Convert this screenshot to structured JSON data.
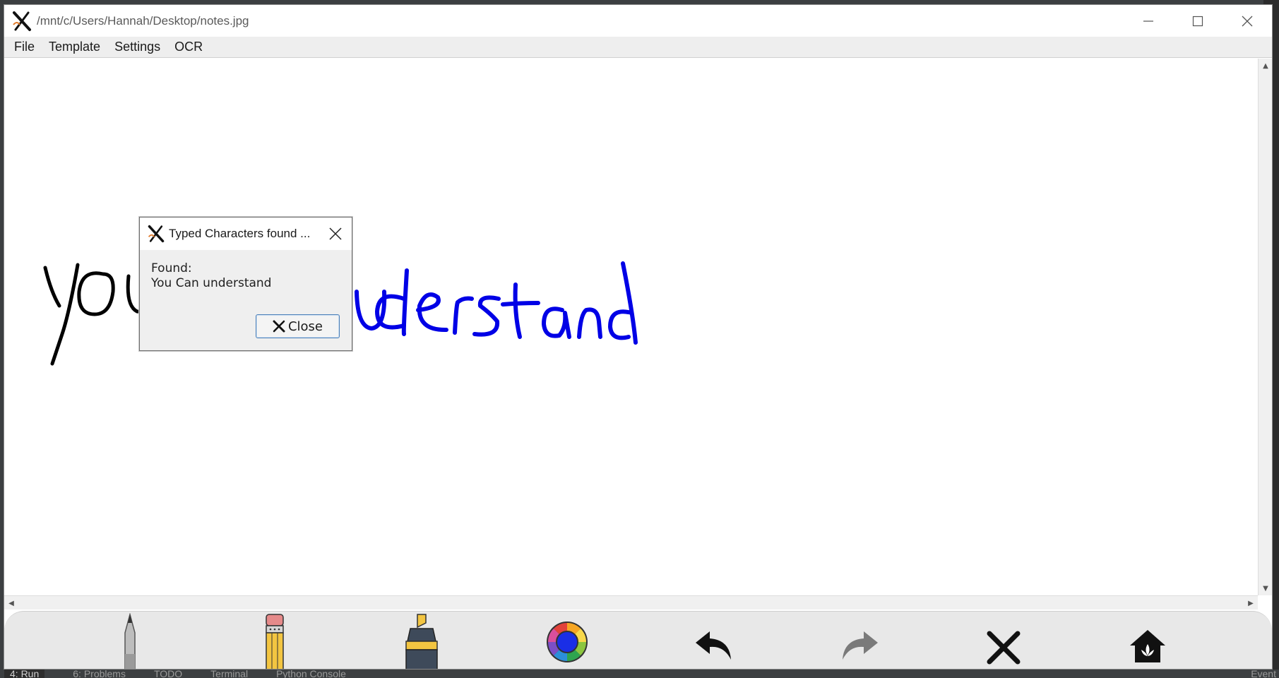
{
  "window": {
    "title": "/mnt/c/Users/Hannah/Desktop/notes.jpg"
  },
  "menu": {
    "items": [
      "File",
      "Template",
      "Settings",
      "OCR"
    ]
  },
  "canvas": {
    "handwriting": [
      {
        "text": "you",
        "color": "#000000"
      },
      {
        "text": "understand",
        "color": "#0000e6"
      }
    ]
  },
  "dialog": {
    "title": "Typed Characters found ...",
    "found_label": "Found:",
    "found_text": "You Can understand",
    "close_label": "Close"
  },
  "toolbar": {
    "tools": [
      "pen-tool",
      "pencil-tool",
      "highlighter-tool",
      "color-wheel",
      "undo",
      "redo",
      "clear",
      "home"
    ]
  },
  "background_ide": {
    "tabs": [
      "4: Run",
      "6: Problems",
      "TODO",
      "Terminal",
      "Python Console"
    ],
    "right_label": "Event"
  },
  "colors": {
    "ink_black": "#000000",
    "ink_blue": "#0000e6",
    "button_border": "#4b7fb8"
  }
}
